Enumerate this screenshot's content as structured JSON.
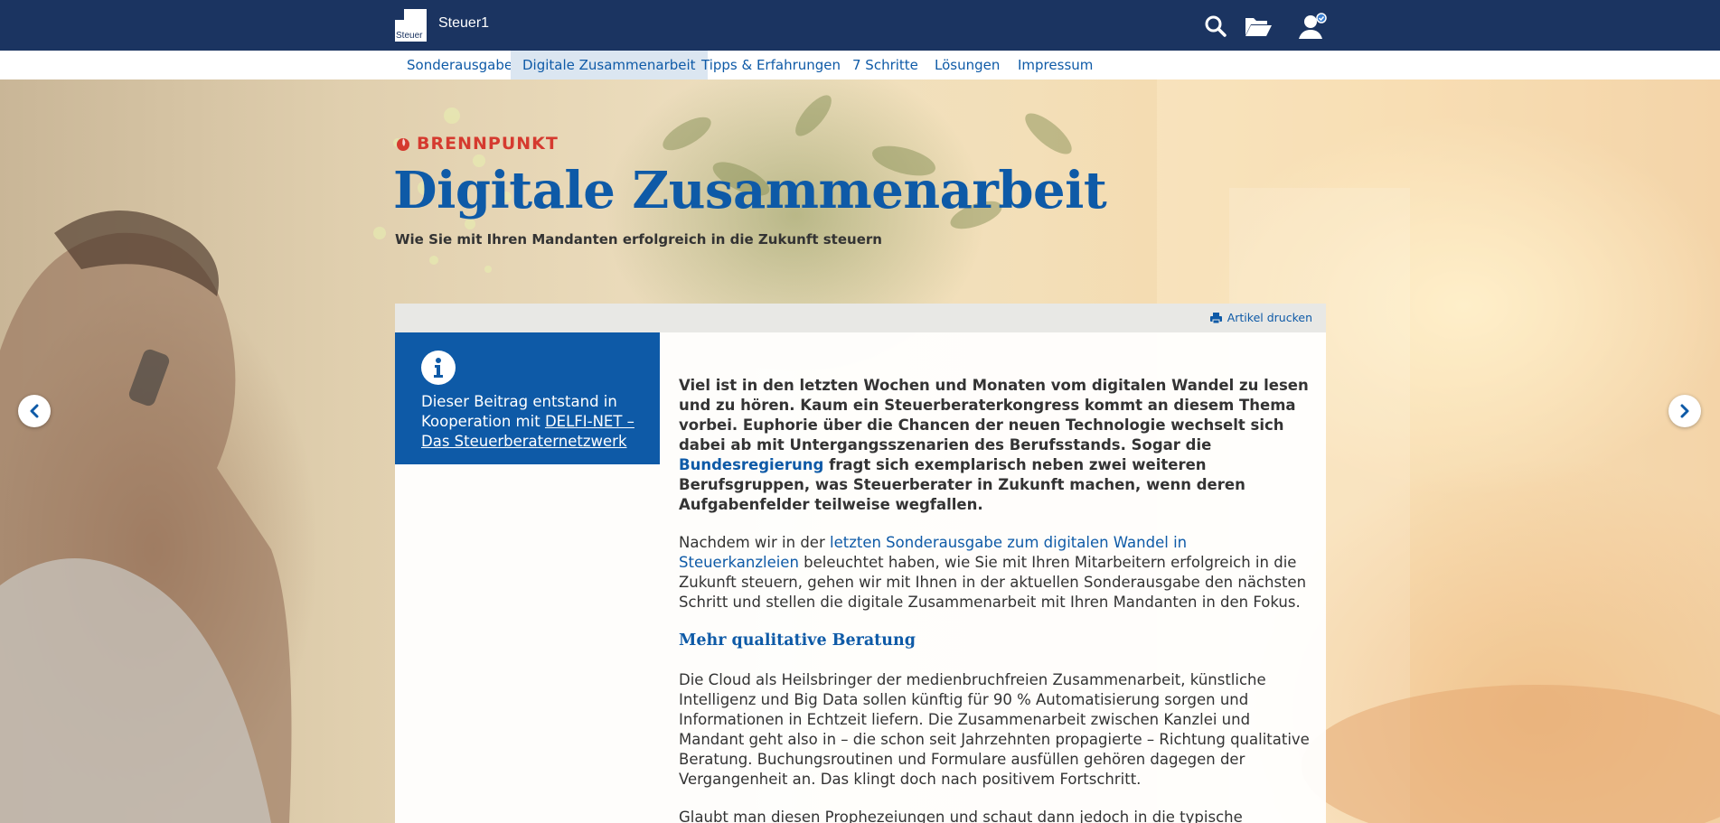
{
  "header": {
    "logo_text": "Steuer",
    "brand": "Steuer1",
    "icons": [
      "search-icon",
      "folder-icon",
      "user-icon"
    ]
  },
  "nav": {
    "items": [
      {
        "label": "Sonderausgabe",
        "active": false
      },
      {
        "label": "Digitale Zusammenarbeit",
        "active": true
      },
      {
        "label": "Tipps & Erfahrungen",
        "active": false
      },
      {
        "label": "7 Schritte",
        "active": false
      },
      {
        "label": "Lösungen",
        "active": false
      },
      {
        "label": "Impressum",
        "active": false
      }
    ]
  },
  "hero": {
    "kicker": "BRENNPUNKT",
    "title": "Digitale Zusammenarbeit",
    "subtitle": "Wie Sie mit Ihren Mandanten erfolgreich in die Zukunft steuern",
    "arrows": [
      "chevron-left-icon",
      "chevron-right-icon"
    ]
  },
  "article": {
    "print_label": "Artikel drucken",
    "info": {
      "text": "Dieser Beitrag entstand in Kooperation mit ",
      "link": "DELFI-NET – Das Steuerberaternetzwerk"
    },
    "lead_before": "Viel ist in den letzten Wochen und Monaten vom digitalen Wandel zu lesen und zu hören. Kaum ein Steuerberaterkongress kommt an diesem Thema vorbei. Euphorie über die Chancen der neuen Technologie wechselt sich dabei ab mit Untergangsszenarien des Berufsstands. Sogar die ",
    "lead_link": "Bundesregierung",
    "lead_after": " fragt sich exemplarisch neben zwei weiteren Berufsgruppen, was Steuerberater in Zukunft machen, wenn deren Aufgabenfelder teilweise wegfallen.",
    "p1_before": "Nachdem wir in der ",
    "p1_link": "letzten Sonderausgabe zum digitalen Wandel in Steuerkanzleien",
    "p1_after": " beleuchtet haben, wie Sie mit Ihren Mitarbeitern erfolgreich in die Zukunft steuern, gehen wir mit Ihnen in der aktuellen Sonderausgabe den nächsten Schritt und stellen die digitale Zusammenarbeit mit Ihren Mandanten in den Fokus.",
    "heading": "Mehr qualitative Beratung",
    "p2": "Die Cloud als Heilsbringer der medienbruchfreien Zusammenarbeit, künstliche Intelligenz und Big Data sollen künftig für 90 % Automatisierung sorgen und Informationen in Echtzeit liefern. Die Zusammenarbeit zwischen Kanzlei und Mandant geht also in – die schon seit Jahrzehnten propagierte – Richtung qualitative Beratung. Buchungsroutinen und Formulare ausfüllen gehören dagegen der Vergangenheit an. Das klingt doch nach positivem Fortschritt.",
    "p3": "Glaubt man diesen Prophezeiungen und schaut dann jedoch in die typische"
  }
}
